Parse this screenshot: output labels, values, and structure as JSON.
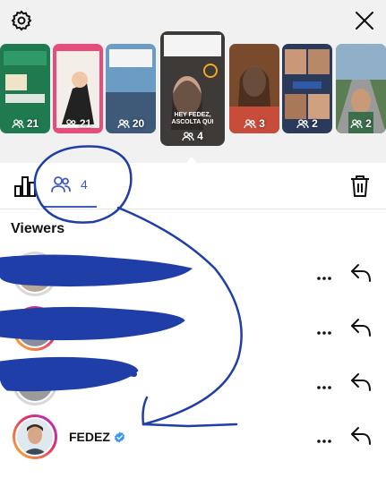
{
  "stories": [
    {
      "views": "21",
      "color": "#1f7a4f",
      "caption": ""
    },
    {
      "views": "21",
      "color": "#e84c7a",
      "caption": ""
    },
    {
      "views": "20",
      "color": "#5a8fb8",
      "caption": ""
    },
    {
      "views": "4",
      "color": "#3d3a38",
      "caption": "HEY FEDEZ,\nASCOLTA QUI"
    },
    {
      "views": "3",
      "color": "#7a4a2d",
      "caption": ""
    },
    {
      "views": "2",
      "color": "#2b3a5a",
      "caption": ""
    },
    {
      "views": "2",
      "color": "#5a7d52",
      "caption": ""
    }
  ],
  "tabs": {
    "viewers_count": "4"
  },
  "viewers_title": "Viewers",
  "viewers": [
    {
      "name": "",
      "redacted": true
    },
    {
      "name": "",
      "redacted": true
    },
    {
      "name": "",
      "redacted": true
    },
    {
      "name": "FEDEZ",
      "verified": true
    }
  ],
  "colors": {
    "accent": "#3f59c0",
    "verified": "#3897f0",
    "scribble": "#1f3ea8"
  }
}
